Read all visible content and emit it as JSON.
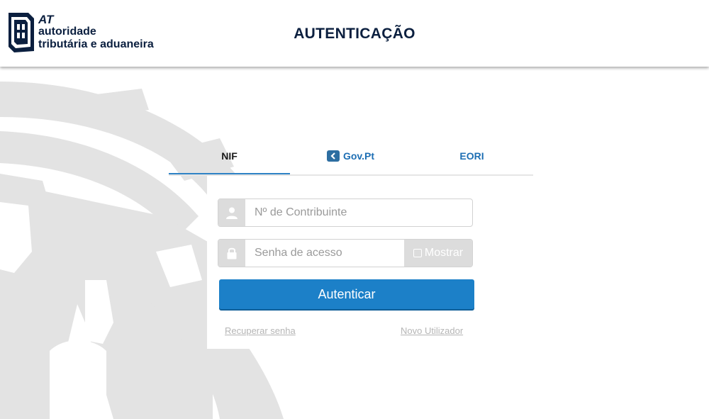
{
  "header": {
    "logo": {
      "abbr": "AT",
      "line1": "autoridade",
      "line2": "tributária e aduaneira"
    },
    "title": "AUTENTICAÇÃO"
  },
  "tabs": [
    {
      "label": "NIF",
      "active": true
    },
    {
      "label": "Gov.Pt",
      "active": false,
      "icon": "gov-pt-icon"
    },
    {
      "label": "EORI",
      "active": false
    }
  ],
  "form": {
    "nif_placeholder": "Nº de Contribuinte",
    "nif_value": "",
    "password_placeholder": "Senha de acesso",
    "password_value": "",
    "show_label": "Mostrar",
    "submit_label": "Autenticar",
    "recover_label": "Recuperar senha",
    "new_user_label": "Novo Utilizador"
  },
  "colors": {
    "brand_navy": "#0b1f3f",
    "accent_blue": "#1c80c8",
    "link_blue": "#1e6fb4",
    "addon_gray": "#dcdcdc"
  }
}
